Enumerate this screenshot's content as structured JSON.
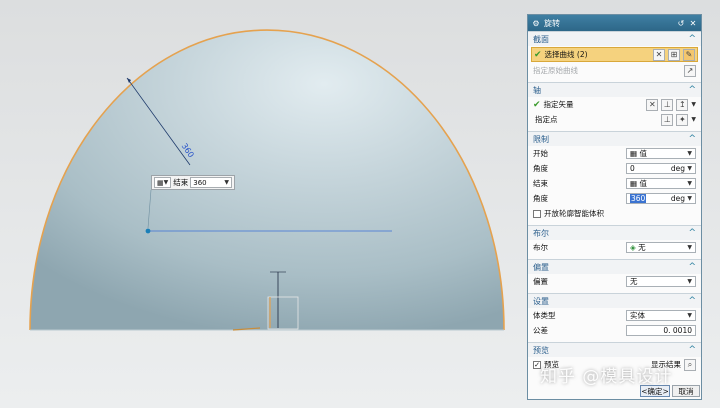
{
  "viewport": {
    "radius_dimension": "360",
    "float_input": {
      "select_label": "值",
      "field_label": "结束",
      "field_value": "360"
    }
  },
  "dialog": {
    "title": "旋转",
    "title_icon": "gear-icon",
    "sections": {
      "section_profile": {
        "title": "截面",
        "select_curve_label": "选择曲线 (2)",
        "origin_curve_label": "指定原始曲线"
      },
      "axis": {
        "title": "轴",
        "vector_label": "指定矢量",
        "point_label": "指定点"
      },
      "limits": {
        "title": "限制",
        "start_label": "开始",
        "start_value": "值",
        "start_angle_label": "角度",
        "start_angle_value": "0",
        "end_label": "结束",
        "end_value": "值",
        "end_angle_label": "角度",
        "end_angle_value": "360",
        "unit": "deg",
        "open_profile_label": "开放轮廓智能体积"
      },
      "boolean": {
        "title": "布尔",
        "label": "布尔",
        "value": "无"
      },
      "offset": {
        "title": "偏置",
        "label": "偏置",
        "value": "无"
      },
      "settings": {
        "title": "设置",
        "body_type_label": "体类型",
        "body_type_value": "实体",
        "tolerance_label": "公差",
        "tolerance_value": "0. 0010"
      },
      "preview": {
        "title": "预览",
        "preview_label": "预览",
        "show_result_label": "显示结果"
      }
    },
    "buttons": {
      "ok": "<确定>",
      "cancel": "取消"
    }
  },
  "watermark": "知乎 @模具设计",
  "colors": {
    "title_bar": "#2d6788",
    "selected_row": "#f5d27e",
    "dimension_blue": "#2b55c9",
    "dome_edge": "#e5a24f"
  }
}
